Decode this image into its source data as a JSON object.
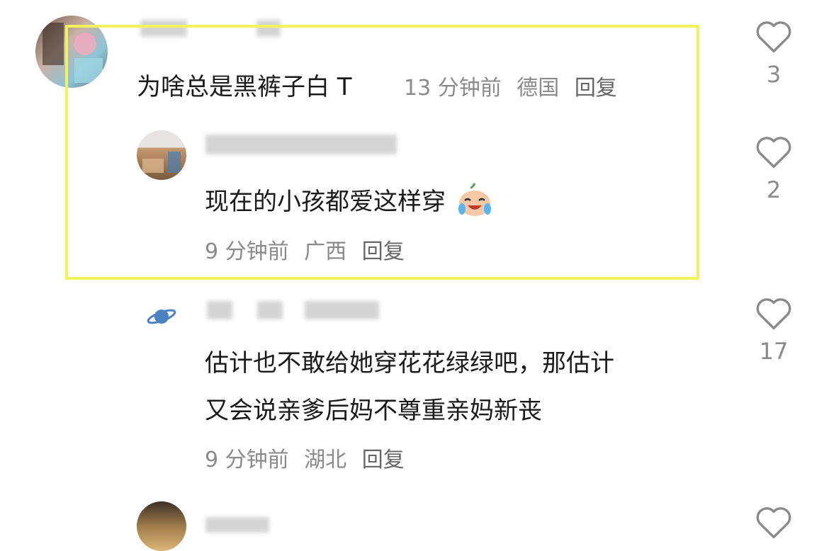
{
  "comments": [
    {
      "text": "为啥总是黑裤子白 T",
      "time": "13 分钟前",
      "location": "德国",
      "reply_label": "回复",
      "likes": "3",
      "replies": [
        {
          "text": "现在的小孩都爱这样穿",
          "emoji": "crying-laughing-face",
          "time": "9 分钟前",
          "location": "广西",
          "reply_label": "回复",
          "likes": "2"
        },
        {
          "text_line1": "估计也不敢给她穿花花绿绿吧，那估计",
          "text_line2": "又会说亲爹后妈不尊重亲妈新丧",
          "time": "9 分钟前",
          "location": "湖北",
          "reply_label": "回复",
          "likes": "17"
        }
      ]
    }
  ],
  "colors": {
    "highlight_border": "#f2f25a",
    "meta_text": "#8a8a8a",
    "main_text": "#1a1a1a"
  }
}
